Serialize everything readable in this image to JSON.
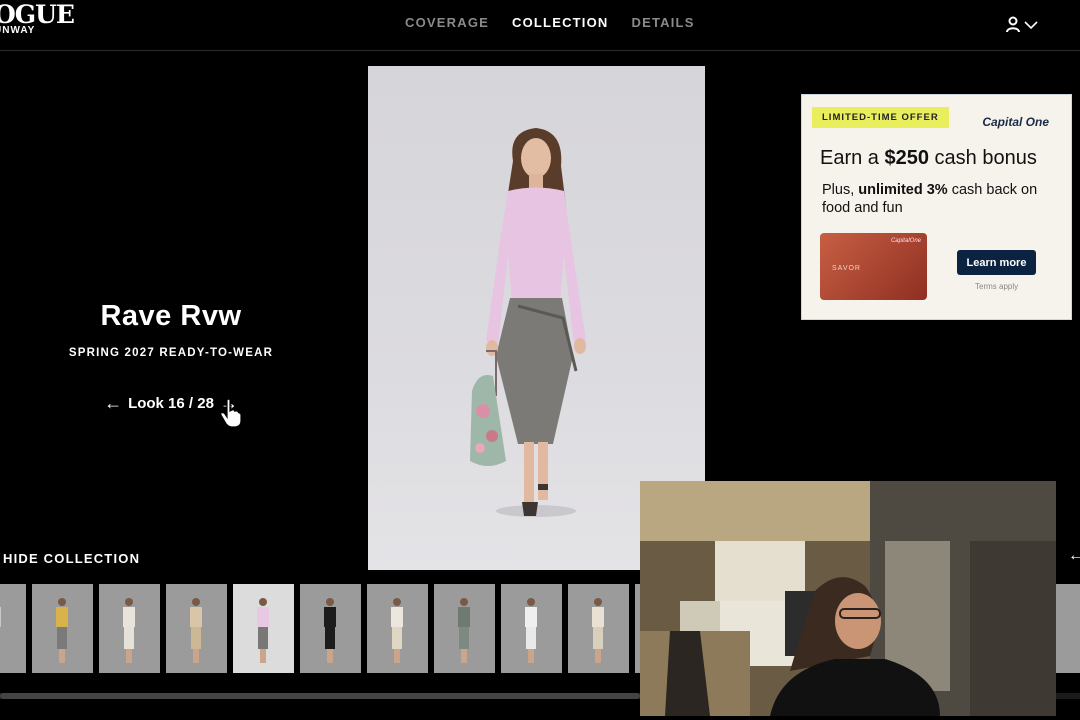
{
  "header": {
    "logo_top": "OGUE",
    "logo_bottom": "UNWAY",
    "nav": [
      {
        "label": "COVERAGE",
        "active": false
      },
      {
        "label": "COLLECTION",
        "active": true
      },
      {
        "label": "DETAILS",
        "active": false
      }
    ],
    "account_icon": "user-icon",
    "account_chevron": "chevron-down-icon"
  },
  "show": {
    "designer": "Rave Rvw",
    "season": "SPRING 2027 READY-TO-WEAR",
    "look_label": "Look 16 / 28",
    "prev_icon": "arrow-left-icon",
    "next_icon": "arrow-right-icon"
  },
  "ad": {
    "badge": "LIMITED-TIME OFFER",
    "brand": "Capital One",
    "headline_pre": "Earn a ",
    "headline_amount": "$250",
    "headline_post": " cash bonus",
    "sub_pre": "Plus, ",
    "sub_bold": "unlimited 3%",
    "sub_post": " cash back on food and fun",
    "card_name": "SAVOR",
    "card_brand": "CapitalOne",
    "cta": "Learn more",
    "terms": "Terms apply"
  },
  "collection": {
    "hide_label": "HIDE COLLECTION",
    "selected_index": 4,
    "thumbs": [
      {
        "top": "#c8c8c8",
        "bottom": "#b0b0b0"
      },
      {
        "top": "#d8b24a",
        "bottom": "#7a7a7a"
      },
      {
        "top": "#e8e4dc",
        "bottom": "#e6e2da"
      },
      {
        "top": "#d9c6a8",
        "bottom": "#cdb895"
      },
      {
        "top": "#e8c9e4",
        "bottom": "#7a7876"
      },
      {
        "top": "#1c1c1c",
        "bottom": "#1c1c1c"
      },
      {
        "top": "#ece7de",
        "bottom": "#e0d6c4"
      },
      {
        "top": "#6f7a70",
        "bottom": "#7e8a80"
      },
      {
        "top": "#efefef",
        "bottom": "#e9e9e9"
      },
      {
        "top": "#e9e2d4",
        "bottom": "#d8cfbd"
      },
      {
        "top": "#f0f0f0",
        "bottom": "#dcdcdc"
      }
    ],
    "right_icon": "arrow-left-icon"
  },
  "colors": {
    "background": "#000000",
    "nav_inactive": "#8a8a8a",
    "ad_badge": "#e9ef5c",
    "ad_cta": "#0b2341"
  }
}
